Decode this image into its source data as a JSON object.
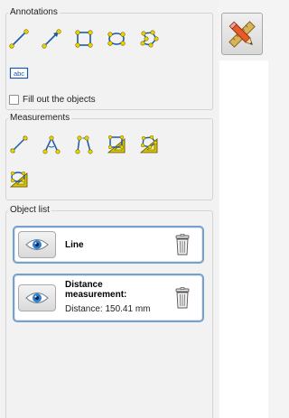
{
  "annotations": {
    "title": "Annotations",
    "tools": [
      {
        "icon": "line-icon"
      },
      {
        "icon": "arrow-icon"
      },
      {
        "icon": "rectangle-icon"
      },
      {
        "icon": "ellipse-icon"
      },
      {
        "icon": "polygon-icon"
      },
      {
        "icon": "text-icon",
        "label": "abc"
      }
    ],
    "fill_label": "Fill out the objects",
    "fill_checked": false
  },
  "measurements": {
    "title": "Measurements",
    "tools": [
      {
        "icon": "distance-measure-icon"
      },
      {
        "icon": "angle-measure-icon"
      },
      {
        "icon": "open-angle-measure-icon"
      },
      {
        "icon": "rectangle-area-measure-icon"
      },
      {
        "icon": "polygon-area-measure-icon"
      },
      {
        "icon": "ellipse-area-measure-icon"
      }
    ]
  },
  "object_list": {
    "title": "Object list",
    "items": [
      {
        "label": "Line",
        "detail": ""
      },
      {
        "label": "Distance measurement:",
        "detail": "Distance: 150.41 mm"
      }
    ]
  },
  "colors": {
    "line": "#1b5aa8",
    "node": "#e8d400",
    "node_stroke": "#7a6a00",
    "card_border": "#7aa0c4"
  }
}
